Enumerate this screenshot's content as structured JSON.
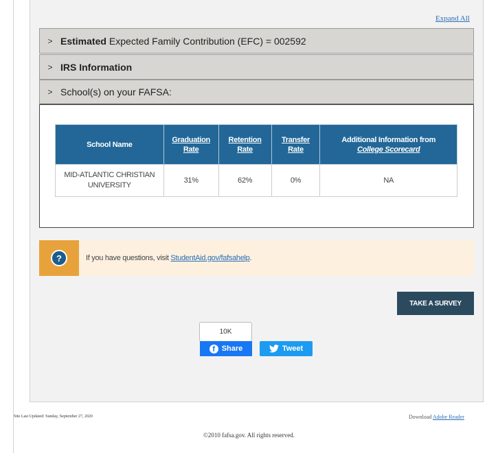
{
  "expand_all": "Expand All",
  "accordions": [
    {
      "bold": "Estimated",
      "text": "Expected Family Contribution (EFC) = 002592"
    },
    {
      "bold": "IRS Information",
      "text": ""
    },
    {
      "bold": "",
      "text": "School(s) on your FAFSA:"
    }
  ],
  "school_table": {
    "headers": {
      "name": "School Name",
      "graduation_line1": "Graduation",
      "graduation_line2": "Rate",
      "retention_line1": "Retention",
      "retention_line2": "Rate",
      "transfer_line1": "Transfer",
      "transfer_line2": "Rate",
      "additional_line1": "Additional Information from",
      "additional_line2": "College Scorecard"
    },
    "rows": [
      {
        "name": "MID-ATLANTIC CHRISTIAN UNIVERSITY",
        "graduation": "31%",
        "retention": "62%",
        "transfer": "0%",
        "additional": "NA"
      }
    ]
  },
  "help": {
    "text": "If you have questions, visit ",
    "link": "StudentAid.gov/fafsahelp",
    "suffix": "."
  },
  "survey_button": "TAKE A SURVEY",
  "social": {
    "share_count": "10K",
    "share_label": "Share",
    "tweet_label": "Tweet"
  },
  "footer": {
    "last_updated": "Site Last Updated: Sunday, September 27, 2020",
    "download_text": "Download",
    "download_link": "Adobe Reader",
    "copyright": "©2010 fafsa.gov. All rights reserved."
  },
  "colors": {
    "table_header": "#226797",
    "help_accent": "#e8a23c",
    "survey_button": "#2c4a5e",
    "facebook": "#1877f2",
    "twitter": "#1d9bf0"
  }
}
